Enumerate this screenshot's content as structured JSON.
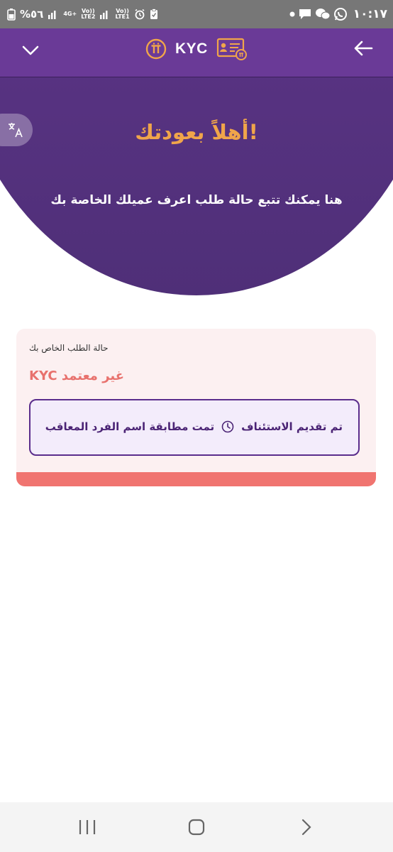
{
  "status_bar": {
    "time": "١٠:١٧",
    "battery": "%٥٦",
    "network_1": [
      "Vo))",
      "LTE1"
    ],
    "network_2": [
      "Vo))",
      "LTE2"
    ],
    "network_3": "4G+"
  },
  "app_bar": {
    "title": "KYC",
    "accent": "#f0a54a",
    "bar_color": "#6a3a97"
  },
  "hero": {
    "title": "!أهلاً بعودتك",
    "subtitle": "هنا يمكنك تتبع حالة طلب اعرف عميلك الخاصة بك"
  },
  "status_card": {
    "label": "حالة الطلب الخاص بك",
    "status": "غير معتمد KYC",
    "status_color": "#e8716d",
    "detail_start": "تم تقديم الاستئناف",
    "detail_end": "تمت مطابقة اسم الفرد المعاقب"
  },
  "icons": {
    "menu": "chevron-down-icon",
    "back": "arrow-right-icon",
    "translate": "translate-icon",
    "pi": "pi-logo-icon",
    "kyc": "id-card-icon",
    "clock": "clock-icon"
  }
}
